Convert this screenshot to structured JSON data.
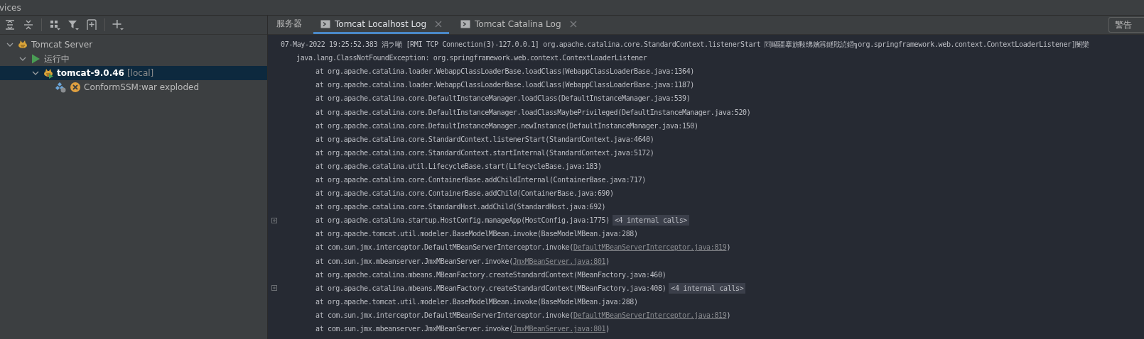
{
  "window": {
    "title": "vices"
  },
  "tree": [
    {
      "label": "Tomcat Server",
      "kind": "server",
      "expanded": true,
      "selected": false,
      "children": [
        {
          "label": "运行中",
          "kind": "running",
          "expanded": true,
          "selected": false,
          "children": [
            {
              "label": "tomcat-9.0.46",
              "suffix": "[local]",
              "kind": "server-running",
              "expanded": true,
              "selected": true,
              "children": [
                {
                  "label": "ConformSSM:war exploded",
                  "kind": "artifact-error",
                  "selected": false
                }
              ]
            }
          ]
        }
      ]
    }
  ],
  "tabs": [
    {
      "label": "服务器",
      "kind": "plain",
      "selected": false
    },
    {
      "label": "Tomcat Localhost Log",
      "kind": "log",
      "selected": true,
      "closable": true
    },
    {
      "label": "Tomcat Catalina Log",
      "kind": "log",
      "selected": false,
      "closable": true
    }
  ],
  "level_filter": {
    "value": "警告"
  },
  "log": [
    {
      "text": "07-May-2022 19:25:52.383 涓ラ噸 [RMI TCP Connection(3)-127.0.0.1] org.apache.catalina.core.StandardContext.listenerStart 閰嶇疆搴旂敤绋嬪簭鐩戝惉鍣╗org.springframework.web.context.ContextLoaderListener]閿欒",
      "children": [
        {
          "text": "java.lang.ClassNotFoundException: org.springframework.web.context.ContextLoaderListener",
          "children": [
            {
              "text": "at org.apache.catalina.loader.WebappClassLoaderBase.loadClass(WebappClassLoaderBase.java:1364)"
            },
            {
              "text": "at org.apache.catalina.loader.WebappClassLoaderBase.loadClass(WebappClassLoaderBase.java:1187)"
            },
            {
              "text": "at org.apache.catalina.core.DefaultInstanceManager.loadClass(DefaultInstanceManager.java:539)"
            },
            {
              "text": "at org.apache.catalina.core.DefaultInstanceManager.loadClassMaybePrivileged(DefaultInstanceManager.java:520)"
            },
            {
              "text": "at org.apache.catalina.core.DefaultInstanceManager.newInstance(DefaultInstanceManager.java:150)"
            },
            {
              "text": "at org.apache.catalina.core.StandardContext.listenerStart(StandardContext.java:4640)"
            },
            {
              "text": "at org.apache.catalina.core.StandardContext.startInternal(StandardContext.java:5172)"
            },
            {
              "text": "at org.apache.catalina.util.LifecycleBase.start(LifecycleBase.java:183)"
            },
            {
              "text": "at org.apache.catalina.core.ContainerBase.addChildInternal(ContainerBase.java:717)"
            },
            {
              "text": "at org.apache.catalina.core.ContainerBase.addChild(ContainerBase.java:690)"
            },
            {
              "text": "at org.apache.catalina.core.StandardHost.addChild(StandardHost.java:692)"
            },
            {
              "text": "at org.apache.catalina.startup.HostConfig.manageApp(HostConfig.java:1775)",
              "collapsed": true,
              "badge": "<4 internal calls>"
            },
            {
              "text": "at org.apache.tomcat.util.modeler.BaseModelMBean.invoke(BaseModelMBean.java:288)"
            },
            {
              "text": "at com.sun.jmx.interceptor.DefaultMBeanServerInterceptor.invoke(",
              "link": "DefaultMBeanServerInterceptor.java:819",
              "tail": ")"
            },
            {
              "text": "at com.sun.jmx.mbeanserver.JmxMBeanServer.invoke(",
              "link": "JmxMBeanServer.java:801",
              "tail": ")"
            },
            {
              "text": "at org.apache.catalina.mbeans.MBeanFactory.createStandardContext(MBeanFactory.java:460)"
            },
            {
              "text": "at org.apache.catalina.mbeans.MBeanFactory.createStandardContext(MBeanFactory.java:408)",
              "collapsed": true,
              "badge": "<4 internal calls>"
            },
            {
              "text": "at org.apache.tomcat.util.modeler.BaseModelMBean.invoke(BaseModelMBean.java:288)"
            },
            {
              "text": "at com.sun.jmx.interceptor.DefaultMBeanServerInterceptor.invoke(",
              "link": "DefaultMBeanServerInterceptor.java:819",
              "tail": ")"
            },
            {
              "text": "at com.sun.jmx.mbeanserver.JmxMBeanServer.invoke(",
              "link": "JmxMBeanServer.java:801",
              "tail": ")"
            }
          ]
        }
      ]
    }
  ]
}
